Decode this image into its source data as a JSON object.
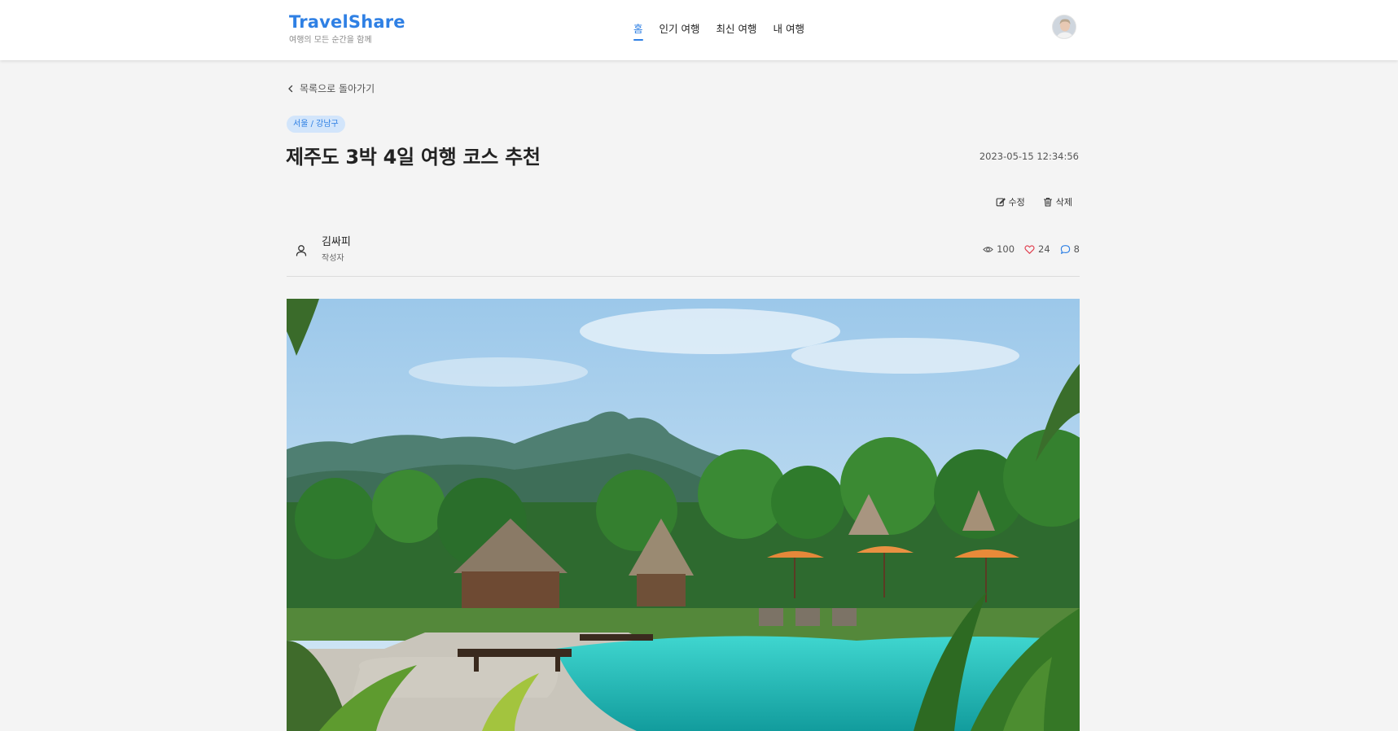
{
  "brand": {
    "name": "TravelShare",
    "tagline": "여행의 모든 순간을 함께"
  },
  "nav": [
    {
      "label": "홈",
      "active": true
    },
    {
      "label": "인기 여행",
      "active": false
    },
    {
      "label": "최신 여행",
      "active": false
    },
    {
      "label": "내 여행",
      "active": false
    }
  ],
  "back_link": "목록으로 돌아가기",
  "post": {
    "region": "서울 / 강남구",
    "title": "제주도 3박 4일 여행 코스 추천",
    "date": "2023-05-15 12:34:56",
    "edit_label": "수정",
    "delete_label": "삭제",
    "author": {
      "name": "김싸피",
      "role": "작성자"
    },
    "stats": {
      "views": "100",
      "likes": "24",
      "comments": "8"
    }
  },
  "colors": {
    "accent": "#2f80e4",
    "like": "#e03b4b",
    "badge_bg": "#d2e5fb",
    "page_bg": "#f4f4f4"
  },
  "icons": [
    "chevron-left-icon",
    "edit-icon",
    "trash-icon",
    "user-icon",
    "eye-icon",
    "heart-icon",
    "comment-icon"
  ]
}
